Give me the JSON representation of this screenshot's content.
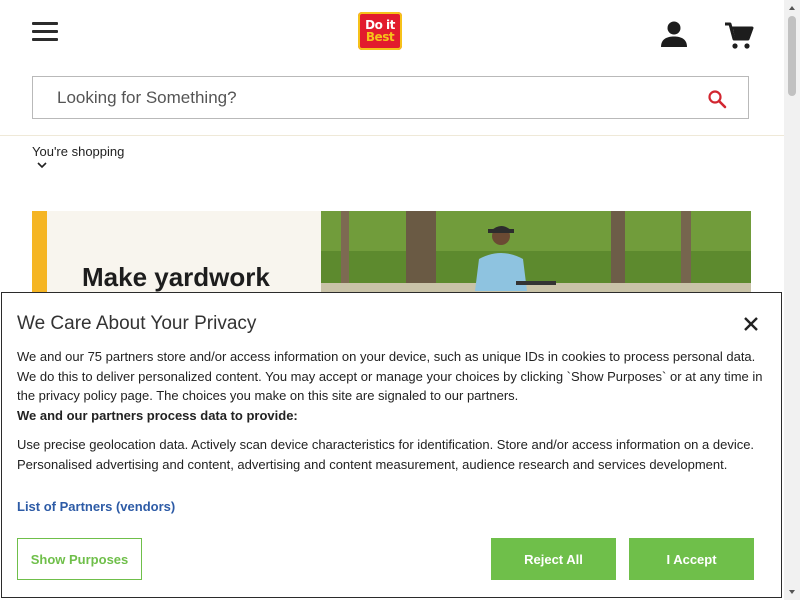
{
  "header": {
    "logo": {
      "line1": "Do it",
      "line2": "Best"
    },
    "icons": {
      "menu": "hamburger-menu-icon",
      "account": "user-icon",
      "cart": "cart-icon"
    }
  },
  "search": {
    "placeholder": "Looking for Something?",
    "value": "",
    "icon": "search-icon"
  },
  "store": {
    "label": "You're shopping",
    "chevron": "chevron-down-icon"
  },
  "hero": {
    "title": "Make yardwork",
    "accent_color": "#f5b523"
  },
  "privacy": {
    "title": "We Care About Your Privacy",
    "intro": "We and our 75 partners store and/or access information on your device, such as unique IDs in cookies to process personal data. We do this to deliver personalized content. You may accept or manage your choices by clicking `Show Purposes` or at any time in the privacy policy page. The choices you make on this site are signaled to our partners.",
    "subheading": "We and our partners process data to provide:",
    "purposes": "Use precise geolocation data. Actively scan device characteristics for identification. Store and/or access information on a device. Personalised advertising and content, advertising and content measurement, audience research and services development.",
    "partners_link": "List of Partners (vendors)",
    "buttons": {
      "show_purposes": "Show Purposes",
      "reject": "Reject All",
      "accept": "I Accept"
    },
    "button_color": "#6fbf4a",
    "link_color": "#2d5ba6"
  }
}
